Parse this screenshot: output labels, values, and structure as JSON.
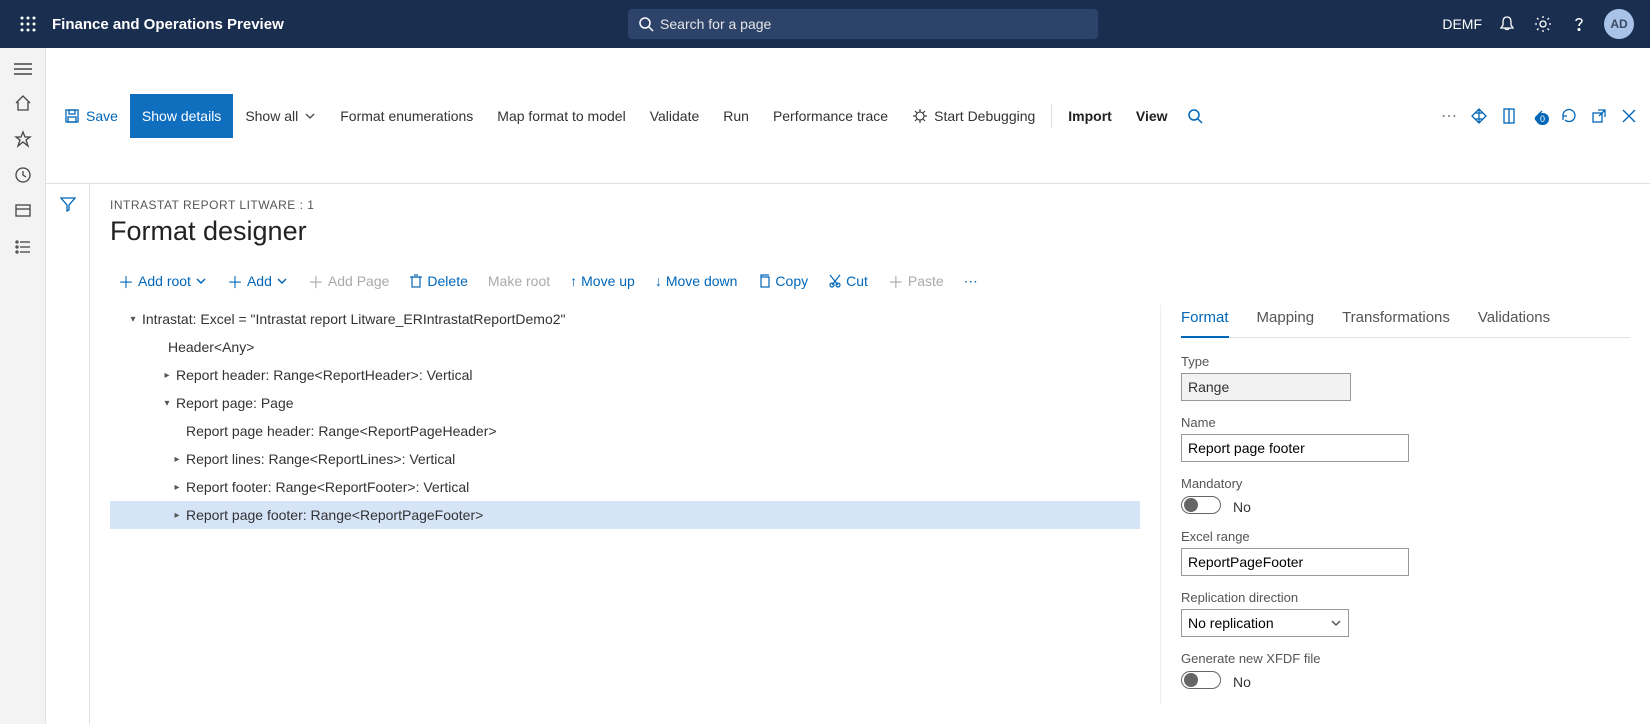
{
  "topbar": {
    "app_title": "Finance and Operations Preview",
    "search_placeholder": "Search for a page",
    "company": "DEMF",
    "avatar": "AD"
  },
  "cmdbar": {
    "save": "Save",
    "show_details": "Show details",
    "show_all": "Show all",
    "format_enum": "Format enumerations",
    "map_format": "Map format to model",
    "validate": "Validate",
    "run": "Run",
    "perf": "Performance trace",
    "debug": "Start Debugging",
    "import": "Import",
    "view": "View"
  },
  "page": {
    "breadcrumb": "INTRASTAT REPORT LITWARE : 1",
    "title": "Format designer"
  },
  "toolbar": {
    "add_root": "Add root",
    "add": "Add",
    "add_page": "Add Page",
    "delete": "Delete",
    "make_root": "Make root",
    "move_up": "Move up",
    "move_down": "Move down",
    "copy": "Copy",
    "cut": "Cut",
    "paste": "Paste"
  },
  "tree": [
    {
      "level": 0,
      "exp": "▾",
      "label": "Intrastat: Excel = \"Intrastat report Litware_ERIntrastatReportDemo2\"",
      "sel": false
    },
    {
      "level": 1,
      "exp": "",
      "label": "Header<Any>",
      "sel": false
    },
    {
      "level": 2,
      "exp": "▸",
      "label": "Report header: Range<ReportHeader>: Vertical",
      "sel": false
    },
    {
      "level": 2,
      "exp": "▾",
      "label": "Report page: Page",
      "sel": false
    },
    {
      "level": 3,
      "exp": "",
      "label": "Report page header: Range<ReportPageHeader>",
      "sel": false
    },
    {
      "level": 3,
      "exp": "▸",
      "label": "Report lines: Range<ReportLines>: Vertical",
      "sel": false
    },
    {
      "level": 3,
      "exp": "▸",
      "label": "Report footer: Range<ReportFooter>: Vertical",
      "sel": false
    },
    {
      "level": 3,
      "exp": "▸",
      "label": "Report page footer: Range<ReportPageFooter>",
      "sel": true
    }
  ],
  "tabs": {
    "format": "Format",
    "mapping": "Mapping",
    "transformations": "Transformations",
    "validations": "Validations"
  },
  "props": {
    "type_label": "Type",
    "type_value": "Range",
    "name_label": "Name",
    "name_value": "Report page footer",
    "mandatory_label": "Mandatory",
    "mandatory_value": "No",
    "excel_label": "Excel range",
    "excel_value": "ReportPageFooter",
    "repl_label": "Replication direction",
    "repl_value": "No replication",
    "xfdf_label": "Generate new XFDF file",
    "xfdf_value": "No"
  }
}
